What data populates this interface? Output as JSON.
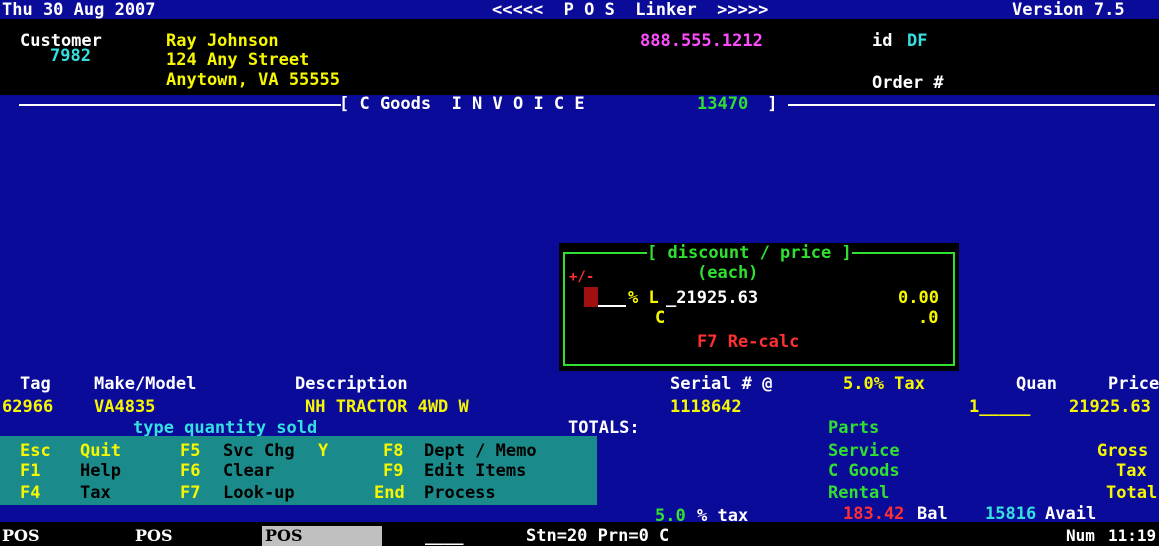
{
  "header": {
    "date": "Thu 30 Aug 2007",
    "title": "<<<<<  P O S  Linker  >>>>>",
    "version": "Version 7.5"
  },
  "customer": {
    "label": "Customer",
    "number": "7982",
    "name": "Ray Johnson",
    "street": "124 Any Street",
    "city": "Anytown, VA 55555",
    "phone": "888.555.1212",
    "id_label": "id",
    "id_value": "DF",
    "order_label": "Order #"
  },
  "invoice": {
    "left": "[ C Goods  I N V O I C E ",
    "number": "13470",
    "right": " ]"
  },
  "popup": {
    "title": "[ discount / price ]",
    "sign": "+/-",
    "each": "(each)",
    "pct": "% L",
    "list_price": "_21925.63",
    "discount": "0.00",
    "c_label": "C",
    "c_value": ".0",
    "recalc": "F7 Re-calc"
  },
  "table": {
    "headers": {
      "tag": "Tag",
      "make": "Make/Model",
      "desc": "Description",
      "serial": "Serial # @",
      "taxrate": "5.0% Tax",
      "quan": "Quan",
      "price": "Price"
    },
    "row": {
      "tag": "62966",
      "make": "VA4835",
      "desc": "NH TRACTOR 4WD W",
      "serial": "1118642",
      "quan": "1_____",
      "price": "21925.63"
    }
  },
  "prompt": "type quantity sold",
  "totals_label": "TOTALS:",
  "categories": [
    "Parts",
    "Service",
    "C Goods",
    "Rental"
  ],
  "summary": [
    "Gross",
    "Tax",
    "Total"
  ],
  "menu": [
    [
      {
        "key": "Esc",
        "label": "Quit"
      },
      {
        "key": "F5",
        "label": "Svc Chg",
        "extra": "Y"
      },
      {
        "key": "F8",
        "label": "Dept / Memo"
      }
    ],
    [
      {
        "key": "F1",
        "label": "Help"
      },
      {
        "key": "F6",
        "label": "Clear"
      },
      {
        "key": "F9",
        "label": "Edit Items"
      }
    ],
    [
      {
        "key": "F4",
        "label": "Tax"
      },
      {
        "key": "F7",
        "label": "Look-up"
      },
      {
        "key": "End",
        "label": "Process"
      }
    ]
  ],
  "status": {
    "tax_rate": "5.0",
    "tax_label": "% tax",
    "balance": "183.42",
    "bal_label": "Bal",
    "avail_value": "15816",
    "avail_label": "Avail"
  },
  "taskbar": {
    "tabs": [
      "POS",
      "POS",
      "POS"
    ],
    "blank": "____",
    "station": "Stn=20 Prn=0  C",
    "numlock": "Num",
    "time": "11:19"
  },
  "colors": {
    "background": "#0b0b99",
    "menu": "#1b8a8a",
    "yellow": "#f7f700",
    "cyan": "#35e0e0",
    "green": "#30e030",
    "magenta": "#ff4cff",
    "red": "#ff3030"
  }
}
